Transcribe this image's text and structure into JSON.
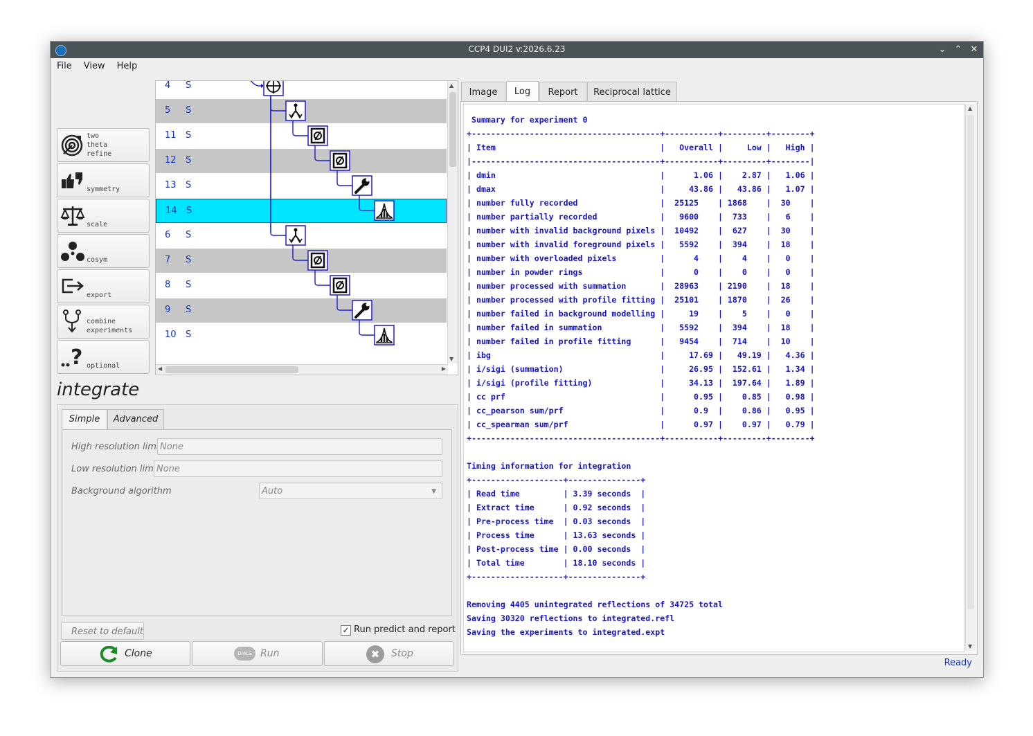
{
  "window": {
    "title": "CCP4 DUI2 v:2026.6.23"
  },
  "menu": [
    "File",
    "View",
    "Help"
  ],
  "tools": [
    {
      "label": "two\ntheta\nrefine",
      "icon": "target-icon"
    },
    {
      "label": "symmetry",
      "icon": "thumbs-icon"
    },
    {
      "label": "scale",
      "icon": "balance-scale-icon"
    },
    {
      "label": "cosym",
      "icon": "cosym-icon"
    },
    {
      "label": "export",
      "icon": "export-icon"
    },
    {
      "label": "combine\nexperiments",
      "icon": "combine-icon"
    },
    {
      "label": "optional",
      "icon": "question-icon"
    }
  ],
  "tree": {
    "rows": [
      {
        "num": "4",
        "status": "S",
        "style": "white"
      },
      {
        "num": "5",
        "status": "S",
        "style": "gray"
      },
      {
        "num": "11",
        "status": "S",
        "style": "white"
      },
      {
        "num": "12",
        "status": "S",
        "style": "gray"
      },
      {
        "num": "13",
        "status": "S",
        "style": "white"
      },
      {
        "num": "14",
        "status": "S",
        "style": "selected"
      },
      {
        "num": "6",
        "status": "S",
        "style": "white"
      },
      {
        "num": "7",
        "status": "S",
        "style": "gray"
      },
      {
        "num": "8",
        "status": "S",
        "style": "white"
      },
      {
        "num": "9",
        "status": "S",
        "style": "gray"
      },
      {
        "num": "10",
        "status": "S",
        "style": "white"
      }
    ]
  },
  "step": {
    "name": "integrate",
    "tabs": [
      "Simple",
      "Advanced"
    ],
    "params": {
      "high_res_label": "High resolution limit",
      "high_res_value": "None",
      "low_res_label": "Low resolution limit",
      "low_res_value": "None",
      "bg_label": "Background algorithm",
      "bg_value": "Auto"
    },
    "reset_label": "Reset to default",
    "run_predict_label": "Run predict and report",
    "clone_label": "Clone",
    "run_label": "Run",
    "stop_label": "Stop",
    "dials_badge": "DIALS"
  },
  "right_tabs": [
    "Image",
    "Log",
    "Report",
    "Reciprocal lattice"
  ],
  "log": {
    "lines": [
      " Summary for experiment 0",
      "+---------------------------------------+-----------+---------+--------+",
      "| Item                                  |   Overall |     Low |   High |",
      "|---------------------------------------+-----------+---------+--------|",
      "| dmin                                  |      1.06 |    2.87 |   1.06 |",
      "| dmax                                  |     43.86 |   43.86 |   1.07 |",
      "| number fully recorded                 |  25125    | 1868    |  30    |",
      "| number partially recorded             |   9600    |  733    |   6    |",
      "| number with invalid background pixels |  10492    |  627    |  30    |",
      "| number with invalid foreground pixels |   5592    |  394    |  18    |",
      "| number with overloaded pixels         |      4    |    4    |   0    |",
      "| number in powder rings                |      0    |    0    |   0    |",
      "| number processed with summation       |  28963    | 2190    |  18    |",
      "| number processed with profile fitting |  25101    | 1870    |  26    |",
      "| number failed in background modelling |     19    |    5    |   0    |",
      "| number failed in summation            |   5592    |  394    |  18    |",
      "| number failed in profile fitting      |   9454    |  714    |  10    |",
      "| ibg                                   |     17.69 |   49.19 |   4.36 |",
      "| i/sigi (summation)                    |     26.95 |  152.61 |   1.34 |",
      "| i/sigi (profile fitting)              |     34.13 |  197.64 |   1.89 |",
      "| cc prf                                |      0.95 |    0.85 |   0.98 |",
      "| cc_pearson sum/prf                    |      0.9  |    0.86 |   0.95 |",
      "| cc_spearman sum/prf                   |      0.97 |    0.97 |   0.79 |",
      "+---------------------------------------+-----------+---------+--------+",
      "",
      "Timing information for integration",
      "+-------------------+---------------+",
      "| Read time         | 3.39 seconds  |",
      "| Extract time      | 0.92 seconds  |",
      "| Pre-process time  | 0.03 seconds  |",
      "| Process time      | 13.63 seconds |",
      "| Post-process time | 0.00 seconds  |",
      "| Total time        | 18.10 seconds |",
      "+-------------------+---------------+",
      "",
      "Removing 4405 unintegrated reflections of 34725 total",
      "Saving 30320 reflections to integrated.refl",
      "Saving the experiments to integrated.expt"
    ]
  },
  "status": "Ready",
  "colors": {
    "selected_row": "#00e5ff",
    "gray_row": "#c6c6c6",
    "log_text": "#1414c8",
    "tree_text": "#1030c0"
  }
}
